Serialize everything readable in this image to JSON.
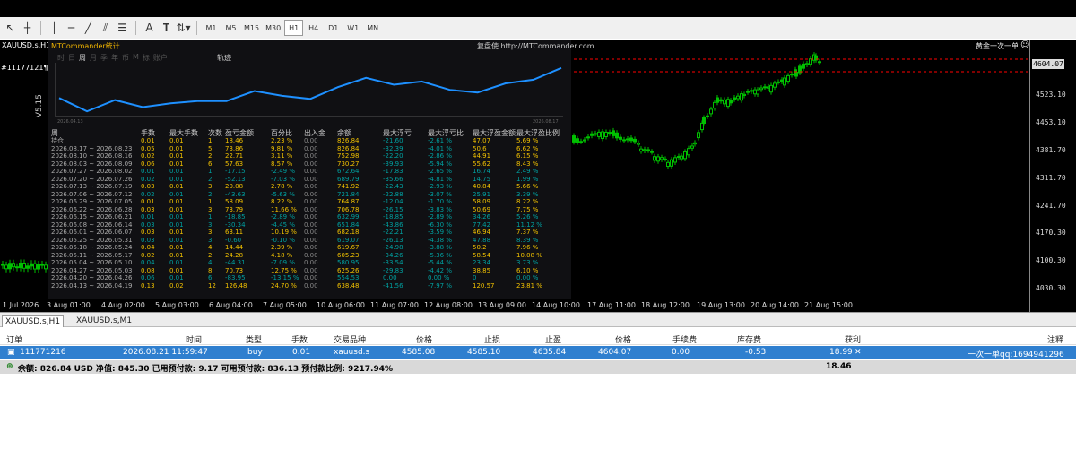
{
  "toolbar": {
    "timeframes": [
      "M1",
      "M5",
      "M15",
      "M30",
      "H1",
      "H4",
      "D1",
      "W1",
      "MN"
    ],
    "active_timeframe": "H1"
  },
  "chart": {
    "symbol": "XAUUSD.s,H1",
    "ticket_label": "#11177121¶",
    "ea_label": "黄金一次一单",
    "version": "V5.15",
    "colors": {
      "candle": "#00c000",
      "background": "#000000",
      "line": "#1e90ff",
      "stop_line": "#ff0000"
    },
    "price_labels": [
      "4604.07",
      "4523.10",
      "4453.10",
      "4381.70",
      "4311.70",
      "4241.70",
      "4170.30",
      "4100.30",
      "4030.30"
    ],
    "current_price": "4604.07",
    "time_labels": [
      "1 Jul 2026",
      "3 Aug 01:00",
      "4 Aug 02:00",
      "5 Aug 03:00",
      "6 Aug 04:00",
      "7 Aug 05:00",
      "10 Aug 06:00",
      "11 Aug 07:00",
      "12 Aug 08:00",
      "13 Aug 09:00",
      "14 Aug 10:00",
      "17 Aug 11:00",
      "18 Aug 12:00",
      "19 Aug 13:00",
      "20 Aug 14:00",
      "21 Aug 15:00"
    ]
  },
  "panel": {
    "title": "MTCommander统计",
    "site": "复盘使 http://MTCommander.com",
    "period_tabs": [
      "时",
      "日",
      "周",
      "月",
      "季",
      "年",
      "币",
      "M",
      "标",
      "账户"
    ],
    "active_period": "周",
    "track_label": "轨迹",
    "mini_dates": [
      "2026.04.13",
      "2026.08.17"
    ],
    "headers": [
      "周",
      "手数",
      "最大手数",
      "次数",
      "盈亏金额",
      "百分比",
      "出入金",
      "余额",
      "最大浮亏",
      "最大浮亏比",
      "最大浮盈金额",
      "最大浮盈比例"
    ],
    "rows": [
      [
        "持仓",
        "0.01",
        "0.01",
        "1",
        "18.46",
        "2.23 %",
        "0.00",
        "826.84",
        "-21.60",
        "-2.61 %",
        "47.07",
        "5.69 %"
      ],
      [
        "2026.08.17 ~ 2026.08.23",
        "0.05",
        "0.01",
        "5",
        "73.86",
        "9.81 %",
        "0.00",
        "826.84",
        "-32.39",
        "-4.01 %",
        "50.6",
        "6.62 %"
      ],
      [
        "2026.08.10 ~ 2026.08.16",
        "0.02",
        "0.01",
        "2",
        "22.71",
        "3.11 %",
        "0.00",
        "752.98",
        "-22.20",
        "-2.86 %",
        "44.91",
        "6.15 %"
      ],
      [
        "2026.08.03 ~ 2026.08.09",
        "0.06",
        "0.01",
        "6",
        "57.63",
        "8.57 %",
        "0.00",
        "730.27",
        "-39.93",
        "-5.94 %",
        "55.62",
        "8.43 %"
      ],
      [
        "2026.07.27 ~ 2026.08.02",
        "0.01",
        "0.01",
        "1",
        "-17.15",
        "-2.49 %",
        "0.00",
        "672.64",
        "-17.83",
        "-2.65 %",
        "16.74",
        "2.49 %"
      ],
      [
        "2026.07.20 ~ 2026.07.26",
        "0.02",
        "0.01",
        "2",
        "-52.13",
        "-7.03 %",
        "0.00",
        "689.79",
        "-35.66",
        "-4.81 %",
        "14.75",
        "1.99 %"
      ],
      [
        "2026.07.13 ~ 2026.07.19",
        "0.03",
        "0.01",
        "3",
        "20.08",
        "2.78 %",
        "0.00",
        "741.92",
        "-22.43",
        "-2.93 %",
        "40.84",
        "5.66 %"
      ],
      [
        "2026.07.06 ~ 2026.07.12",
        "0.02",
        "0.01",
        "2",
        "-43.63",
        "-5.63 %",
        "0.00",
        "721.84",
        "-22.88",
        "-3.07 %",
        "25.91",
        "3.39 %"
      ],
      [
        "2026.06.29 ~ 2026.07.05",
        "0.01",
        "0.01",
        "1",
        "58.09",
        "8.22 %",
        "0.00",
        "764.87",
        "-12.04",
        "-1.70 %",
        "58.09",
        "8.22 %"
      ],
      [
        "2026.06.22 ~ 2026.06.28",
        "0.03",
        "0.01",
        "3",
        "73.79",
        "11.66 %",
        "0.00",
        "706.78",
        "-26.15",
        "-3.83 %",
        "50.69",
        "7.75 %"
      ],
      [
        "2026.06.15 ~ 2026.06.21",
        "0.01",
        "0.01",
        "1",
        "-18.85",
        "-2.89 %",
        "0.00",
        "632.99",
        "-18.85",
        "-2.89 %",
        "34.26",
        "5.26 %"
      ],
      [
        "2026.06.08 ~ 2026.06.14",
        "0.03",
        "0.01",
        "3",
        "-30.34",
        "-4.45 %",
        "0.00",
        "651.84",
        "-43.86",
        "-6.30 %",
        "77.42",
        "11.12 %"
      ],
      [
        "2026.06.01 ~ 2026.06.07",
        "0.03",
        "0.01",
        "3",
        "63.11",
        "10.19 %",
        "0.00",
        "682.18",
        "-22.21",
        "-3.59 %",
        "46.94",
        "7.37 %"
      ],
      [
        "2026.05.25 ~ 2026.05.31",
        "0.03",
        "0.01",
        "3",
        "-0.60",
        "-0.10 %",
        "0.00",
        "619.07",
        "-26.13",
        "-4.38 %",
        "47.88",
        "8.39 %"
      ],
      [
        "2026.05.18 ~ 2026.05.24",
        "0.04",
        "0.01",
        "4",
        "14.44",
        "2.39 %",
        "0.00",
        "619.67",
        "-24.98",
        "-3.88 %",
        "50.2",
        "7.96 %"
      ],
      [
        "2026.05.11 ~ 2026.05.17",
        "0.02",
        "0.01",
        "2",
        "24.28",
        "4.18 %",
        "0.00",
        "605.23",
        "-34.26",
        "-5.36 %",
        "58.54",
        "10.08 %"
      ],
      [
        "2026.05.04 ~ 2026.05.10",
        "0.04",
        "0.01",
        "4",
        "-44.31",
        "-7.09 %",
        "0.00",
        "580.95",
        "-33.54",
        "-5.44 %",
        "23.34",
        "3.73 %"
      ],
      [
        "2026.04.27 ~ 2026.05.03",
        "0.08",
        "0.01",
        "8",
        "70.73",
        "12.75 %",
        "0.00",
        "625.26",
        "-29.83",
        "-4.42 %",
        "38.85",
        "6.10 %"
      ],
      [
        "2026.04.20 ~ 2026.04.26",
        "0.06",
        "0.01",
        "6",
        "-83.95",
        "-13.15 %",
        "0.00",
        "554.53",
        "0.00",
        "0.00 %",
        "0",
        "0.00 %"
      ],
      [
        "2026.04.13 ~ 2026.04.19",
        "0.13",
        "0.02",
        "12",
        "126.48",
        "24.70 %",
        "0.00",
        "638.48",
        "-41.56",
        "-7.97 %",
        "120.57",
        "23.81 %"
      ]
    ]
  },
  "chart_tabs": [
    "XAUUSD.s,H1",
    "XAUUSD.s,M1"
  ],
  "terminal": {
    "headers": [
      "订单",
      "时间",
      "类型",
      "手数",
      "交易品种",
      "价格",
      "止损",
      "止盈",
      "价格",
      "手续费",
      "库存费",
      "获利",
      "注释"
    ],
    "order": {
      "ticket": "111771216",
      "time": "2026.08.21 11:59:47",
      "type": "buy",
      "lots": "0.01",
      "symbol": "xauusd.s",
      "open_price": "4585.08",
      "sl": "4585.10",
      "tp": "4635.84",
      "price": "4604.07",
      "commission": "0.00",
      "swap": "-0.53",
      "profit": "18.99",
      "comment": "一次一单qq:1694941296"
    },
    "balance": {
      "text": "余额: 826.84 USD  净值: 845.30  已用预付款: 9.17  可用预付款: 836.13  预付款比例: 9217.94%",
      "total_profit": "18.46"
    }
  }
}
